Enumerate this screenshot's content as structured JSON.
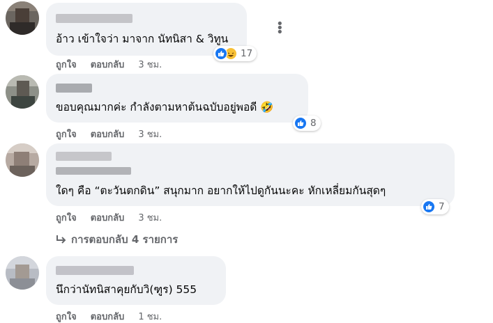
{
  "comments": [
    {
      "text": "อ้าว เข้าใจว่า มาจาก นัทนิสา & วิทูน",
      "reaction_count": "17",
      "reactions": [
        "like-icon",
        "haha-icon"
      ],
      "actions": {
        "like": "ถูกใจ",
        "reply": "ตอบกลับ",
        "time": "3 ชม."
      }
    },
    {
      "text": "ขอบคุณมากค่ะ กำลังตามหาต้นฉบับอยู่พอดี 🤣",
      "reaction_count": "8",
      "reactions": [
        "like-icon"
      ],
      "actions": {
        "like": "ถูกใจ",
        "reply": "ตอบกลับ",
        "time": "3 ชม."
      }
    },
    {
      "text": "ใดๆ คือ “ตะวันตกดิน” สนุกมาก อยากให้ไปดูกันนะคะ หักเหลี่ยมกันสุดๆ",
      "reaction_count": "7",
      "reactions": [
        "like-icon"
      ],
      "actions": {
        "like": "ถูกใจ",
        "reply": "ตอบกลับ",
        "time": "3 ชม."
      },
      "view_replies": "การตอบกลับ 4 รายการ"
    },
    {
      "text": "นึกว่านัทนิสาคุยกับวิ(ฑูร) 555",
      "actions": {
        "like": "ถูกใจ",
        "reply": "ตอบกลับ",
        "time": "1 ชม."
      }
    }
  ],
  "colors": {
    "bubble": "#f0f2f5",
    "like_blue": "#1877f2",
    "meta_gray": "#65676b"
  }
}
